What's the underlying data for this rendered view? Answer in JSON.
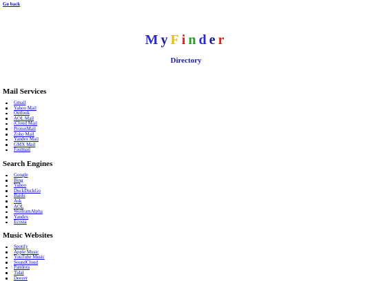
{
  "nav": {
    "back_label": "Go back"
  },
  "header": {
    "logo_letters": [
      {
        "char": "M",
        "color": "#2a2ad0"
      },
      {
        "char": "y",
        "color": "#1a1a9a"
      },
      {
        "char": "F",
        "color": "#e8c000"
      },
      {
        "char": "i",
        "color": "#dd2222"
      },
      {
        "char": "n",
        "color": "#22a022"
      },
      {
        "char": "d",
        "color": "#2a2ad0"
      },
      {
        "char": "e",
        "color": "#1a1a9a"
      },
      {
        "char": "r",
        "color": "#dd2222"
      }
    ],
    "subtitle": "Directory"
  },
  "sections": [
    {
      "title": "Mail Services",
      "items": [
        "Gmail",
        "Yahoo Mail",
        "Outlook",
        "AOL Mail",
        "iCloud Mail",
        "ProtonMail",
        "Zoho Mail",
        "Yandex Mail",
        "GMX Mail",
        "Fastmail"
      ]
    },
    {
      "title": "Search Engines",
      "items": [
        "Google",
        "Bing",
        "Yahoo",
        "DuckDuckGo",
        "Baidu",
        "Ask",
        "AOL",
        "WolframAlpha",
        "Yandex",
        "Ecosia"
      ]
    },
    {
      "title": "Music Websites",
      "items": [
        "Spotify",
        "Apple Music",
        "YouTube Music",
        "SoundCloud",
        "Pandora",
        "Tidal",
        "Deezer"
      ]
    }
  ]
}
